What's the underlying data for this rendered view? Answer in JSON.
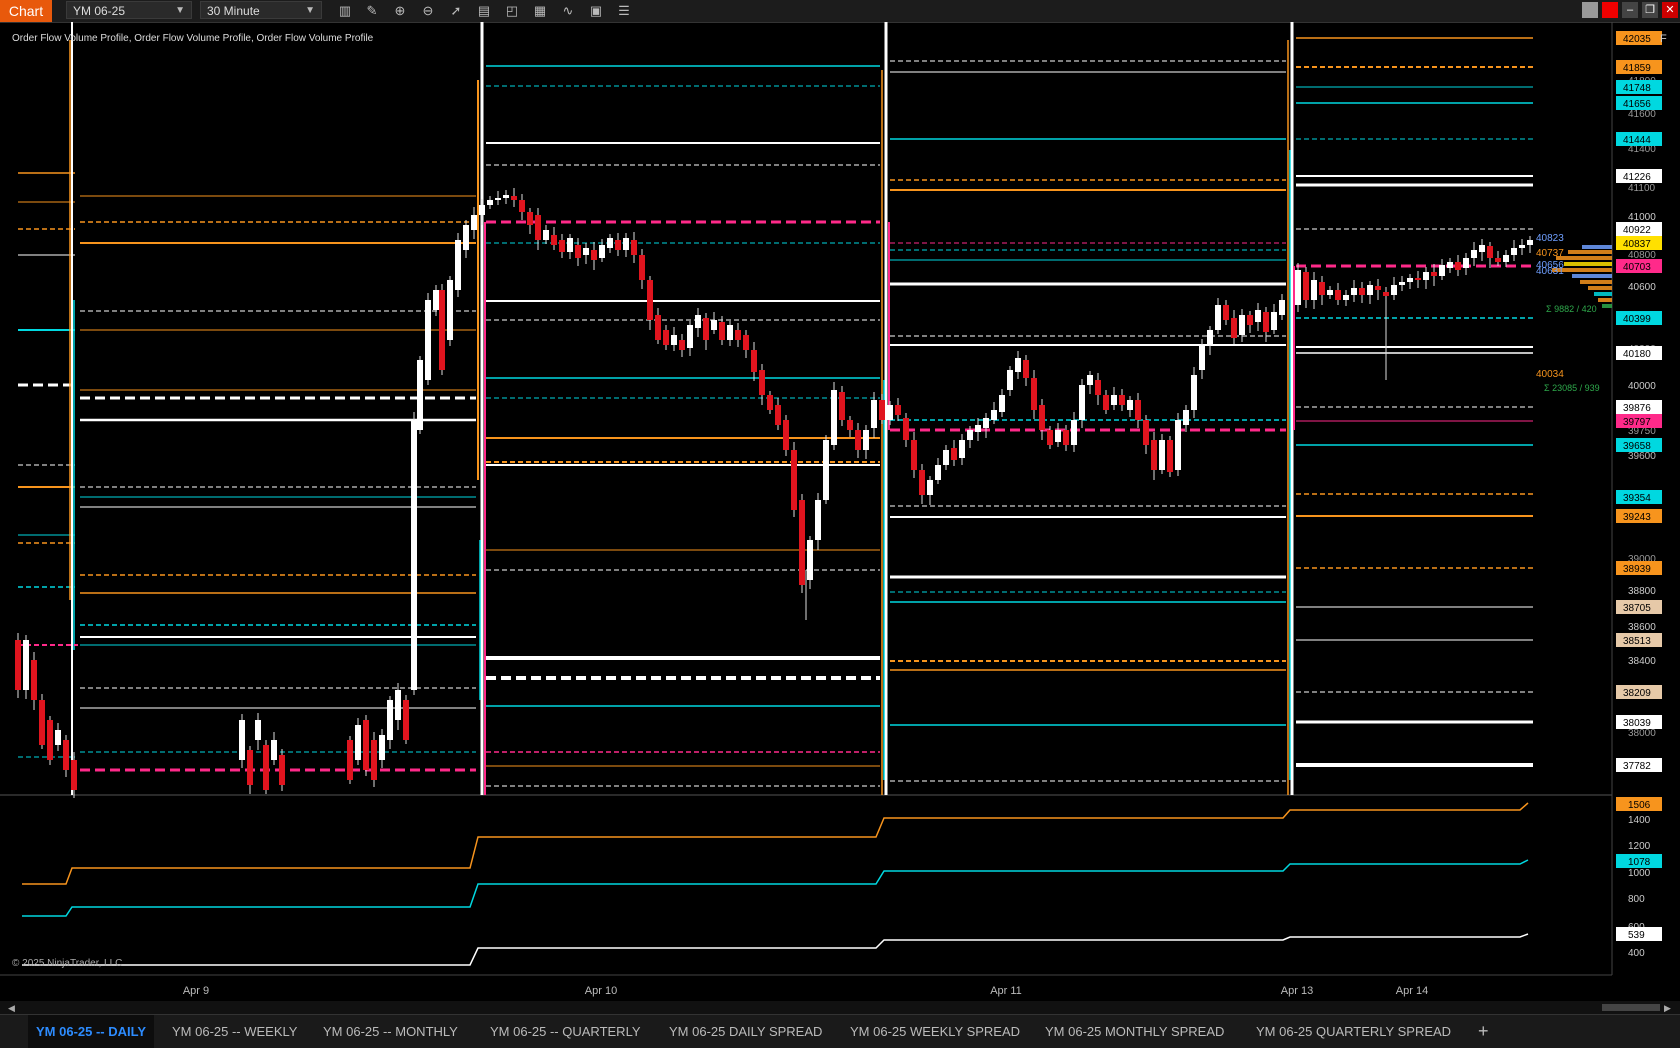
{
  "toolbar": {
    "chart_tab": "Chart",
    "instrument": "YM 06-25",
    "interval": "30 Minute",
    "tools": [
      "bar-style-icon",
      "pencil-icon",
      "zoom-in-icon",
      "zoom-out-icon",
      "pointer-icon",
      "properties-icon",
      "template-icon",
      "indicators-icon",
      "strategies-icon",
      "order-flow-icon",
      "data-box-icon"
    ],
    "window_buttons": [
      "tile-icon",
      "close-all-icon",
      "minimize-icon",
      "maximize-icon",
      "close-icon"
    ]
  },
  "chart": {
    "indicator_title": "Order Flow Volume Profile, Order Flow Volume Profile, Order Flow Volume Profile",
    "copyright": "© 2025 NinjaTrader, LLC",
    "f_badge": "F",
    "x_labels": [
      "Apr 9",
      "Apr 10",
      "Apr 11",
      "Apr 13",
      "Apr 14"
    ],
    "price_axis_ticks": [
      "41000",
      "40600",
      "40000",
      "39600",
      "38800",
      "38600",
      "38400"
    ],
    "price_axis_partial": [
      "41800",
      "41600",
      "41400",
      "41100",
      "40800",
      "40300",
      "39750",
      "39600",
      "39200",
      "39000",
      "38000"
    ],
    "price_labels": [
      {
        "text": "42035",
        "color": "#f7941d"
      },
      {
        "text": "41859",
        "color": "#f7941d"
      },
      {
        "text": "41748",
        "color": "#00d8e0"
      },
      {
        "text": "41656",
        "color": "#00d8e0"
      },
      {
        "text": "41444",
        "color": "#00d8e0"
      },
      {
        "text": "41226",
        "color": "#ffffff"
      },
      {
        "text": "40922",
        "color": "#ffffff"
      },
      {
        "text": "40837",
        "color": "#ffe000"
      },
      {
        "text": "40703",
        "color": "#ff2a8a"
      },
      {
        "text": "40399",
        "color": "#00d8e0"
      },
      {
        "text": "40180",
        "color": "#ffffff"
      },
      {
        "text": "39876",
        "color": "#ffffff"
      },
      {
        "text": "39797",
        "color": "#ff2a8a"
      },
      {
        "text": "39658",
        "color": "#00d8e0"
      },
      {
        "text": "39354",
        "color": "#00d8e0"
      },
      {
        "text": "39243",
        "color": "#f7941d"
      },
      {
        "text": "38939",
        "color": "#f7941d"
      },
      {
        "text": "38705",
        "color": "#e6c9a8"
      },
      {
        "text": "38513",
        "color": "#e6c9a8"
      },
      {
        "text": "38209",
        "color": "#e6c9a8"
      },
      {
        "text": "38039",
        "color": "#ffffff"
      },
      {
        "text": "37782",
        "color": "#ffffff"
      }
    ],
    "profile_labels": {
      "a": "40823",
      "b": "40737",
      "c": "40656",
      "d": "40631",
      "e": "40034",
      "sum1": "Σ 23085 / 939",
      "sum2": "Σ 9882 / 420"
    }
  },
  "sub_panel": {
    "ticks": [
      "1400",
      "1200",
      "1000",
      "800",
      "600",
      "400"
    ],
    "labels": [
      {
        "text": "1506",
        "color": "#f7941d"
      },
      {
        "text": "1078",
        "color": "#00d8e0"
      },
      {
        "text": "539",
        "color": "#ffffff"
      }
    ]
  },
  "bottom_tabs": [
    {
      "label": "YM 06-25 -- DAILY",
      "active": true
    },
    {
      "label": "YM 06-25 -- WEEKLY",
      "active": false
    },
    {
      "label": "YM 06-25 -- MONTHLY",
      "active": false
    },
    {
      "label": "YM 06-25 -- QUARTERLY",
      "active": false
    },
    {
      "label": "YM 06-25 DAILY SPREAD",
      "active": false
    },
    {
      "label": "YM 06-25 WEEKLY SPREAD",
      "active": false
    },
    {
      "label": "YM 06-25 MONTHLY SPREAD",
      "active": false
    },
    {
      "label": "YM 06-25 QUARTERLY SPREAD",
      "active": false
    }
  ],
  "add_tab": "+",
  "colors": {
    "orange": "#f7941d",
    "cyan": "#00d8e0",
    "white": "#ffffff",
    "magenta": "#ff2a8a",
    "bull": "#ffffff",
    "bear": "#e0141e",
    "active_tab": "#2d8cff"
  }
}
